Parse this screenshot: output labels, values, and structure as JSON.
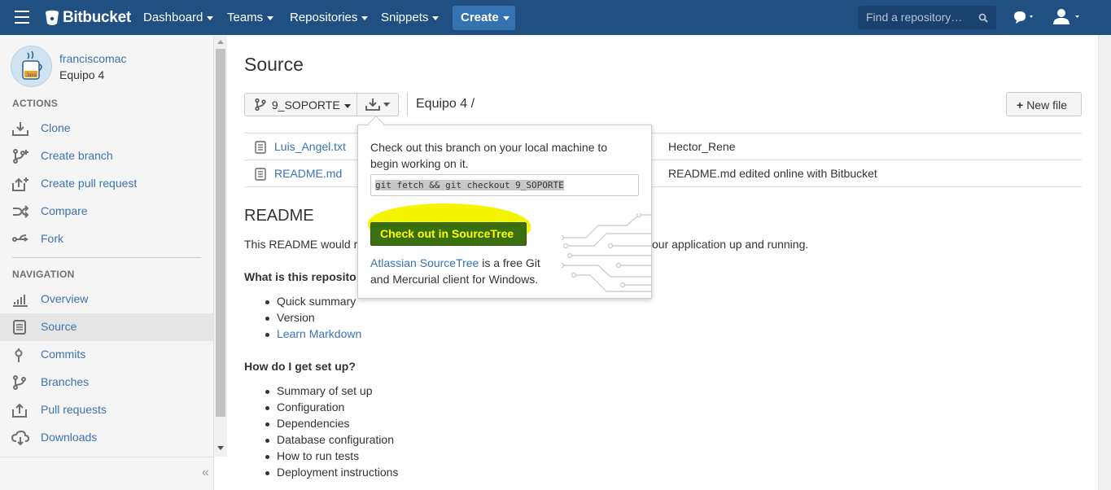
{
  "topnav": {
    "brand": "Bitbucket",
    "items": [
      "Dashboard",
      "Teams",
      "Repositories",
      "Snippets"
    ],
    "create_label": "Create",
    "search_placeholder": "Find a repository…"
  },
  "sidebar": {
    "account_name": "franciscomac",
    "team_name": "Equipo 4",
    "avatar_text": "Java",
    "actions_heading": "ACTIONS",
    "actions": [
      {
        "label": "Clone",
        "icon": "clone-icon"
      },
      {
        "label": "Create branch",
        "icon": "branch-icon"
      },
      {
        "label": "Create pull request",
        "icon": "pull-request-icon"
      },
      {
        "label": "Compare",
        "icon": "compare-icon"
      },
      {
        "label": "Fork",
        "icon": "fork-icon"
      }
    ],
    "navigation_heading": "NAVIGATION",
    "navigation": [
      {
        "label": "Overview",
        "icon": "overview-icon"
      },
      {
        "label": "Source",
        "icon": "source-icon",
        "active": true
      },
      {
        "label": "Commits",
        "icon": "commits-icon"
      },
      {
        "label": "Branches",
        "icon": "branches-icon"
      },
      {
        "label": "Pull requests",
        "icon": "pull-requests-icon"
      },
      {
        "label": "Downloads",
        "icon": "downloads-icon"
      }
    ],
    "collapse_glyph": "«"
  },
  "main": {
    "title": "Source",
    "branch": "9_SOPORTE",
    "breadcrumb": "Equipo 4 /",
    "new_file_label": "New file",
    "files": [
      {
        "name": "Luis_Angel.txt",
        "message": "Hector_Rene"
      },
      {
        "name": "README.md",
        "message": "README.md edited online with Bitbucket"
      }
    ],
    "readme": {
      "title": "README",
      "intro_start": "This README would r",
      "intro_end": "our application up and running.",
      "q1": "What is this reposito",
      "list1": [
        "Quick summary",
        "Version",
        "Learn Markdown"
      ],
      "q2": "How do I get set up?",
      "list2": [
        "Summary of set up",
        "Configuration",
        "Dependencies",
        "Database configuration",
        "How to run tests",
        "Deployment instructions"
      ]
    }
  },
  "popover": {
    "text": "Check out this branch on your local machine to begin working on it.",
    "command": "git fetch && git checkout 9_SOPORTE",
    "button_label": "Check out in SourceTree",
    "desc_link": "Atlassian SourceTree",
    "desc_rest": " is a free Git and Mercurial client for Windows."
  },
  "colors": {
    "header": "#205081",
    "link": "#3b73af",
    "highlight": "#f5f500",
    "sourcetree_button": "#3a6f10"
  }
}
